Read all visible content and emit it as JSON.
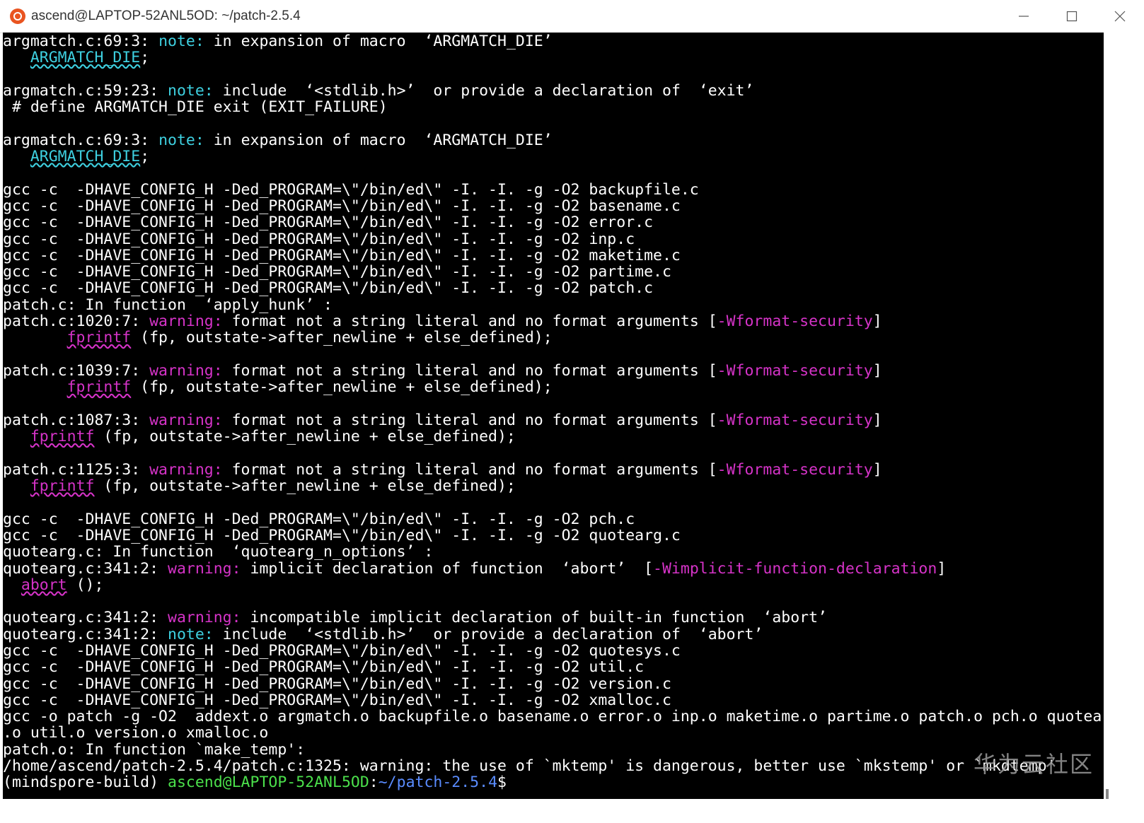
{
  "window": {
    "title": "ascend@LAPTOP-52ANL5OD: ~/patch-2.5.4",
    "icon": "ubuntu-icon",
    "controls": [
      "minimize-icon",
      "maximize-icon",
      "close-icon"
    ]
  },
  "colors": {
    "note": "#3ed0e0",
    "warning": "#d633c8",
    "prompt_user": "#4be04b",
    "prompt_path": "#5a8cff",
    "background": "#000000",
    "text": "#ffffff"
  },
  "terminal": {
    "lines": [
      [
        {
          "t": "argmatch.c:69:3: "
        },
        {
          "t": "note:",
          "c": "note"
        },
        {
          "t": " in expansion of macro  ‘ARGMATCH_DIE’"
        }
      ],
      [
        {
          "t": "   "
        },
        {
          "t": "ARGMATCH_DIE",
          "c": "ul-cyan"
        },
        {
          "t": ";"
        }
      ],
      [
        {
          "t": ""
        }
      ],
      [
        {
          "t": "argmatch.c:59:23: "
        },
        {
          "t": "note:",
          "c": "note"
        },
        {
          "t": " include  ‘<stdlib.h>’  or provide a declaration of  ‘exit’"
        }
      ],
      [
        {
          "t": " # define ARGMATCH_DIE exit (EXIT_FAILURE)"
        }
      ],
      [
        {
          "t": ""
        }
      ],
      [
        {
          "t": "argmatch.c:69:3: "
        },
        {
          "t": "note:",
          "c": "note"
        },
        {
          "t": " in expansion of macro  ‘ARGMATCH_DIE’"
        }
      ],
      [
        {
          "t": "   "
        },
        {
          "t": "ARGMATCH_DIE",
          "c": "ul-cyan"
        },
        {
          "t": ";"
        }
      ],
      [
        {
          "t": ""
        }
      ],
      [
        {
          "t": "gcc -c  -DHAVE_CONFIG_H -Ded_PROGRAM=\\\"/bin/ed\\\" -I. -I. -g -O2 backupfile.c"
        }
      ],
      [
        {
          "t": "gcc -c  -DHAVE_CONFIG_H -Ded_PROGRAM=\\\"/bin/ed\\\" -I. -I. -g -O2 basename.c"
        }
      ],
      [
        {
          "t": "gcc -c  -DHAVE_CONFIG_H -Ded_PROGRAM=\\\"/bin/ed\\\" -I. -I. -g -O2 error.c"
        }
      ],
      [
        {
          "t": "gcc -c  -DHAVE_CONFIG_H -Ded_PROGRAM=\\\"/bin/ed\\\" -I. -I. -g -O2 inp.c"
        }
      ],
      [
        {
          "t": "gcc -c  -DHAVE_CONFIG_H -Ded_PROGRAM=\\\"/bin/ed\\\" -I. -I. -g -O2 maketime.c"
        }
      ],
      [
        {
          "t": "gcc -c  -DHAVE_CONFIG_H -Ded_PROGRAM=\\\"/bin/ed\\\" -I. -I. -g -O2 partime.c"
        }
      ],
      [
        {
          "t": "gcc -c  -DHAVE_CONFIG_H -Ded_PROGRAM=\\\"/bin/ed\\\" -I. -I. -g -O2 patch.c"
        }
      ],
      [
        {
          "t": "patch.c: In function  ‘apply_hunk’ :"
        }
      ],
      [
        {
          "t": "patch.c:1020:7: "
        },
        {
          "t": "warning:",
          "c": "warn"
        },
        {
          "t": " format not a string literal and no format arguments ["
        },
        {
          "t": "-Wformat-security",
          "c": "flag"
        },
        {
          "t": "]"
        }
      ],
      [
        {
          "t": "       "
        },
        {
          "t": "fprintf",
          "c": "ul-mag"
        },
        {
          "t": " (fp, outstate->after_newline + else_defined);"
        }
      ],
      [
        {
          "t": ""
        }
      ],
      [
        {
          "t": "patch.c:1039:7: "
        },
        {
          "t": "warning:",
          "c": "warn"
        },
        {
          "t": " format not a string literal and no format arguments ["
        },
        {
          "t": "-Wformat-security",
          "c": "flag"
        },
        {
          "t": "]"
        }
      ],
      [
        {
          "t": "       "
        },
        {
          "t": "fprintf",
          "c": "ul-mag"
        },
        {
          "t": " (fp, outstate->after_newline + else_defined);"
        }
      ],
      [
        {
          "t": ""
        }
      ],
      [
        {
          "t": "patch.c:1087:3: "
        },
        {
          "t": "warning:",
          "c": "warn"
        },
        {
          "t": " format not a string literal and no format arguments ["
        },
        {
          "t": "-Wformat-security",
          "c": "flag"
        },
        {
          "t": "]"
        }
      ],
      [
        {
          "t": "   "
        },
        {
          "t": "fprintf",
          "c": "ul-mag"
        },
        {
          "t": " (fp, outstate->after_newline + else_defined);"
        }
      ],
      [
        {
          "t": ""
        }
      ],
      [
        {
          "t": "patch.c:1125:3: "
        },
        {
          "t": "warning:",
          "c": "warn"
        },
        {
          "t": " format not a string literal and no format arguments ["
        },
        {
          "t": "-Wformat-security",
          "c": "flag"
        },
        {
          "t": "]"
        }
      ],
      [
        {
          "t": "   "
        },
        {
          "t": "fprintf",
          "c": "ul-mag"
        },
        {
          "t": " (fp, outstate->after_newline + else_defined);"
        }
      ],
      [
        {
          "t": ""
        }
      ],
      [
        {
          "t": "gcc -c  -DHAVE_CONFIG_H -Ded_PROGRAM=\\\"/bin/ed\\\" -I. -I. -g -O2 pch.c"
        }
      ],
      [
        {
          "t": "gcc -c  -DHAVE_CONFIG_H -Ded_PROGRAM=\\\"/bin/ed\\\" -I. -I. -g -O2 quotearg.c"
        }
      ],
      [
        {
          "t": "quotearg.c: In function  ‘quotearg_n_options’ :"
        }
      ],
      [
        {
          "t": "quotearg.c:341:2: "
        },
        {
          "t": "warning:",
          "c": "warn"
        },
        {
          "t": " implicit declaration of function  ‘abort’  ["
        },
        {
          "t": "-Wimplicit-function-declaration",
          "c": "flag"
        },
        {
          "t": "]"
        }
      ],
      [
        {
          "t": "  "
        },
        {
          "t": "abort",
          "c": "ul-mag"
        },
        {
          "t": " ();"
        }
      ],
      [
        {
          "t": ""
        }
      ],
      [
        {
          "t": "quotearg.c:341:2: "
        },
        {
          "t": "warning:",
          "c": "warn"
        },
        {
          "t": " incompatible implicit declaration of built-in function  ‘abort’"
        }
      ],
      [
        {
          "t": "quotearg.c:341:2: "
        },
        {
          "t": "note:",
          "c": "note"
        },
        {
          "t": " include  ‘<stdlib.h>’  or provide a declaration of  ‘abort’"
        }
      ],
      [
        {
          "t": "gcc -c  -DHAVE_CONFIG_H -Ded_PROGRAM=\\\"/bin/ed\\\" -I. -I. -g -O2 quotesys.c"
        }
      ],
      [
        {
          "t": "gcc -c  -DHAVE_CONFIG_H -Ded_PROGRAM=\\\"/bin/ed\\\" -I. -I. -g -O2 util.c"
        }
      ],
      [
        {
          "t": "gcc -c  -DHAVE_CONFIG_H -Ded_PROGRAM=\\\"/bin/ed\\\" -I. -I. -g -O2 version.c"
        }
      ],
      [
        {
          "t": "gcc -c  -DHAVE_CONFIG_H -Ded_PROGRAM=\\\"/bin/ed\\\" -I. -I. -g -O2 xmalloc.c"
        }
      ],
      [
        {
          "t": "gcc -o patch -g -O2  addext.o argmatch.o backupfile.o basename.o error.o inp.o maketime.o partime.o patch.o pch.o quotearg.o quotesys"
        }
      ],
      [
        {
          "t": ".o util.o version.o xmalloc.o"
        }
      ],
      [
        {
          "t": "patch.o: In function `make_temp':"
        }
      ],
      [
        {
          "t": "/home/ascend/patch-2.5.4/patch.c:1325: warning: the use of `mktemp' is dangerous, better use `mkstemp' or `mkdtemp'"
        }
      ],
      [
        {
          "t": "(mindspore-build) "
        },
        {
          "t": "ascend@LAPTOP-52ANL5OD",
          "c": "prompt-user"
        },
        {
          "t": ":"
        },
        {
          "t": "~/patch-2.5.4",
          "c": "prompt-path"
        },
        {
          "t": "$"
        }
      ]
    ]
  },
  "watermark": "华为云社区"
}
